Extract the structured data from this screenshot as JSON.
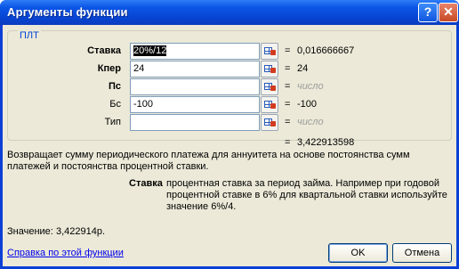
{
  "window": {
    "title": "Аргументы функции",
    "help_button": "?",
    "close_button": "✕"
  },
  "group": {
    "label": "ПЛТ"
  },
  "args": [
    {
      "name": "Ставка",
      "bold": true,
      "value_selected": "20%/12",
      "value": "",
      "result": "0,016666667",
      "hint": false
    },
    {
      "name": "Кпер",
      "bold": true,
      "value_selected": "",
      "value": "24",
      "result": "24",
      "hint": false
    },
    {
      "name": "Пс",
      "bold": true,
      "value_selected": "",
      "value": "",
      "result": "число",
      "hint": true
    },
    {
      "name": "Бс",
      "bold": false,
      "value_selected": "",
      "value": "-100",
      "result": "-100",
      "hint": false
    },
    {
      "name": "Тип",
      "bold": false,
      "value_selected": "",
      "value": "",
      "result": "число",
      "hint": true
    }
  ],
  "equals": "=",
  "total_result": "3,422913598",
  "description": "Возвращает сумму периодического платежа для аннуитета на основе постоянства сумм платежей и постоянства процентной ставки.",
  "current_arg": {
    "name": "Ставка",
    "text": "процентная ставка за период займа. Например при годовой процентной ставке в 6% для квартальной ставки используйте значение 6%/4."
  },
  "value_label": "Значение:",
  "value": "3,422914р.",
  "help_link": "Справка по этой функции",
  "buttons": {
    "ok": "OK",
    "cancel": "Отмена"
  },
  "icons": {
    "ref": "collapse-dialog-icon"
  }
}
